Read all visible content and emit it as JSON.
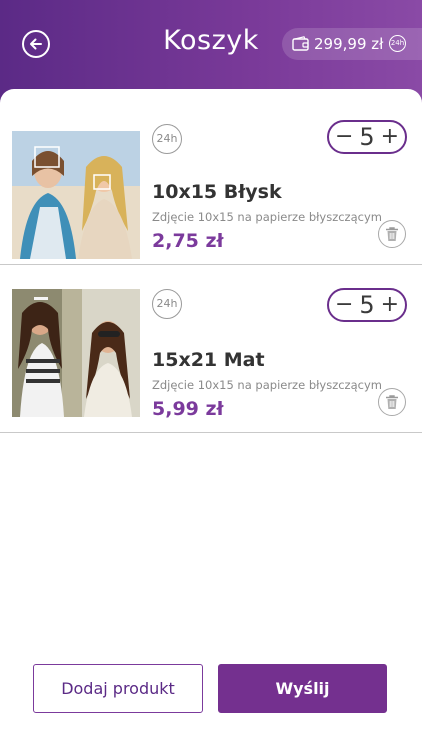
{
  "header": {
    "title": "Koszyk",
    "wallet_amount": "299,99 zł",
    "wallet_badge": "24h",
    "back_icon": "arrow-left-circle-icon",
    "wallet_icon": "wallet-icon"
  },
  "items": [
    {
      "badge": "24h",
      "quantity": "5",
      "minus": "−",
      "plus": "+",
      "name": "10x15 Błysk",
      "description": "Zdjęcie 10x15 na papierze błyszczącym",
      "price": "2,75 zł"
    },
    {
      "badge": "24h",
      "quantity": "5",
      "minus": "−",
      "plus": "+",
      "name": "15x21 Mat",
      "description": "Zdjęcie 10x15 na papierze błyszczącym",
      "price": "5,99 zł"
    }
  ],
  "footer": {
    "add_product": "Dodaj produkt",
    "send": "Wyślij"
  },
  "colors": {
    "brand": "#74308f",
    "accent_text": "#7b3a9c"
  }
}
